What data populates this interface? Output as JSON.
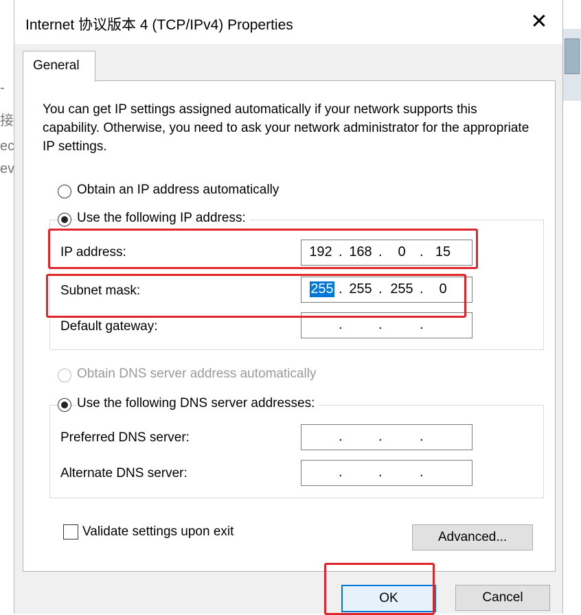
{
  "window": {
    "title": "Internet 协议版本 4 (TCP/IPv4) Properties",
    "close_glyph": "✕"
  },
  "background": {
    "left_fragments": [
      "-",
      "接",
      "ec",
      "ev"
    ]
  },
  "tabs": [
    {
      "label": "General",
      "active": true
    }
  ],
  "intro_text": "You can get IP settings assigned automatically if your network supports this capability. Otherwise, you need to ask your network administrator for the appropriate IP settings.",
  "ip_options": {
    "auto_label": "Obtain an IP address automatically",
    "auto_selected": false,
    "manual_label": "Use the following IP address:",
    "manual_selected": true,
    "fields": {
      "ip": {
        "label": "IP address:",
        "octets": [
          "192",
          "168",
          "0",
          "15"
        ]
      },
      "subnet": {
        "label": "Subnet mask:",
        "octets": [
          "255",
          "255",
          "255",
          "0"
        ],
        "selected_octet": 0
      },
      "gateway": {
        "label": "Default gateway:",
        "octets": [
          "",
          "",
          "",
          ""
        ]
      }
    }
  },
  "dns_options": {
    "auto_label": "Obtain DNS server address automatically",
    "auto_disabled": true,
    "manual_label": "Use the following DNS server addresses:",
    "manual_selected": true,
    "fields": {
      "preferred": {
        "label": "Preferred DNS server:",
        "octets": [
          "",
          "",
          "",
          ""
        ]
      },
      "alternate": {
        "label": "Alternate DNS server:",
        "octets": [
          "",
          "",
          "",
          ""
        ]
      }
    }
  },
  "validate": {
    "label": "Validate settings upon exit",
    "checked": false
  },
  "buttons": {
    "advanced": "Advanced...",
    "ok": "OK",
    "cancel": "Cancel"
  },
  "colors": {
    "highlight_box": "#e0242a",
    "selection": "#0078d7"
  }
}
